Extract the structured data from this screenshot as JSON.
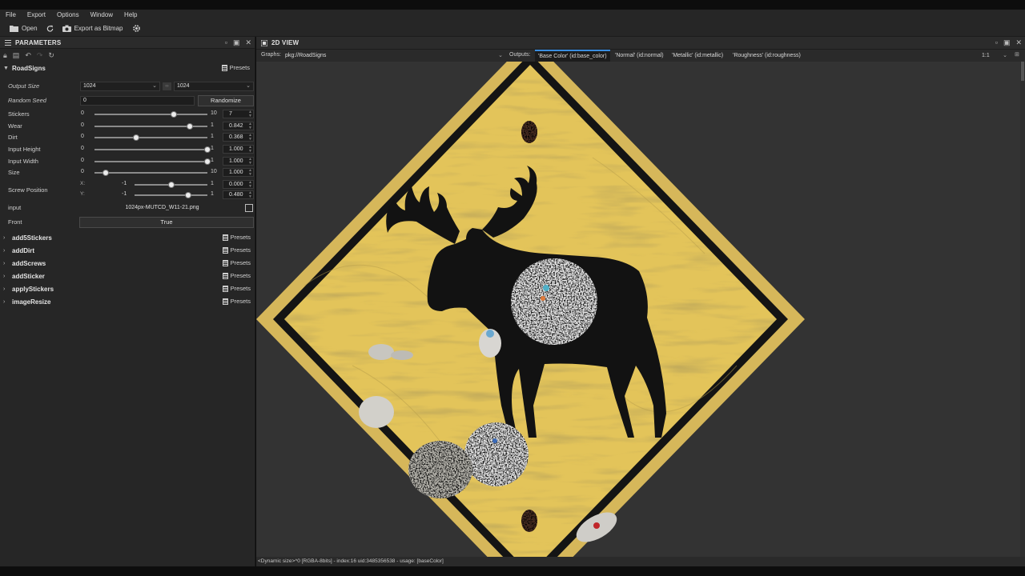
{
  "menu": [
    "File",
    "Export",
    "Options",
    "Window",
    "Help"
  ],
  "toolbar": {
    "open_label": "Open",
    "export_label": "Export as Bitmap"
  },
  "parameters_panel": {
    "title": "PARAMETERS",
    "presets_label": "Presets",
    "root_group": "RoadSigns",
    "output_size": {
      "label": "Output Size",
      "width": "1024",
      "height": "1024"
    },
    "random_seed": {
      "label": "Random Seed",
      "value": "0",
      "button": "Randomize"
    },
    "sliders": [
      {
        "label": "Stickers",
        "min": "0",
        "max": "10",
        "value": "7",
        "level": 0.7
      },
      {
        "label": "Wear",
        "min": "0",
        "max": "1",
        "value": "0.842",
        "level": 0.842
      },
      {
        "label": "Dirt",
        "min": "0",
        "max": "1",
        "value": "0.368",
        "level": 0.368
      },
      {
        "label": "Input Height",
        "min": "0",
        "max": "1",
        "value": "1.000",
        "level": 1.0
      },
      {
        "label": "Input Width",
        "min": "0",
        "max": "1",
        "value": "1.000",
        "level": 1.0
      },
      {
        "label": "Size",
        "min": "0",
        "max": "10",
        "value": "1.000",
        "level": 0.1
      }
    ],
    "screw_position": {
      "label": "Screw Position",
      "x": {
        "axis": "X:",
        "min": "-1",
        "max": "1",
        "value": "0.000",
        "level": 0.5
      },
      "y": {
        "axis": "Y:",
        "min": "-1",
        "max": "1",
        "value": "0.480",
        "level": 0.74
      }
    },
    "input": {
      "label": "input",
      "value": "1024px-MUTCD_W11-21.png"
    },
    "front": {
      "label": "Front",
      "value": "True"
    },
    "groups": [
      "add5Stickers",
      "addDirt",
      "addScrews",
      "addSticker",
      "applyStickers",
      "imageResize"
    ]
  },
  "view": {
    "title": "2D VIEW",
    "graphs_label": "Graphs:",
    "graph_value": "pkg://RoadSigns",
    "outputs_label": "Outputs:",
    "outputs": [
      "'Base Color' (id:base_color)",
      "'Normal' (id:normal)",
      "'Metallic' (id:metallic)",
      "'Roughness' (id:roughness)"
    ],
    "zoom": "1:1",
    "status": "<Dynamic size>^0 [RGBA-8bits] - index:16 uid:3485356538 - usage: [baseColor]"
  },
  "colors": {
    "sign_yellow": "#e3c45a",
    "sign_black": "#141414",
    "accent_blue": "#3a8de0",
    "panel_bg": "#262626",
    "view_bg": "#333333"
  }
}
